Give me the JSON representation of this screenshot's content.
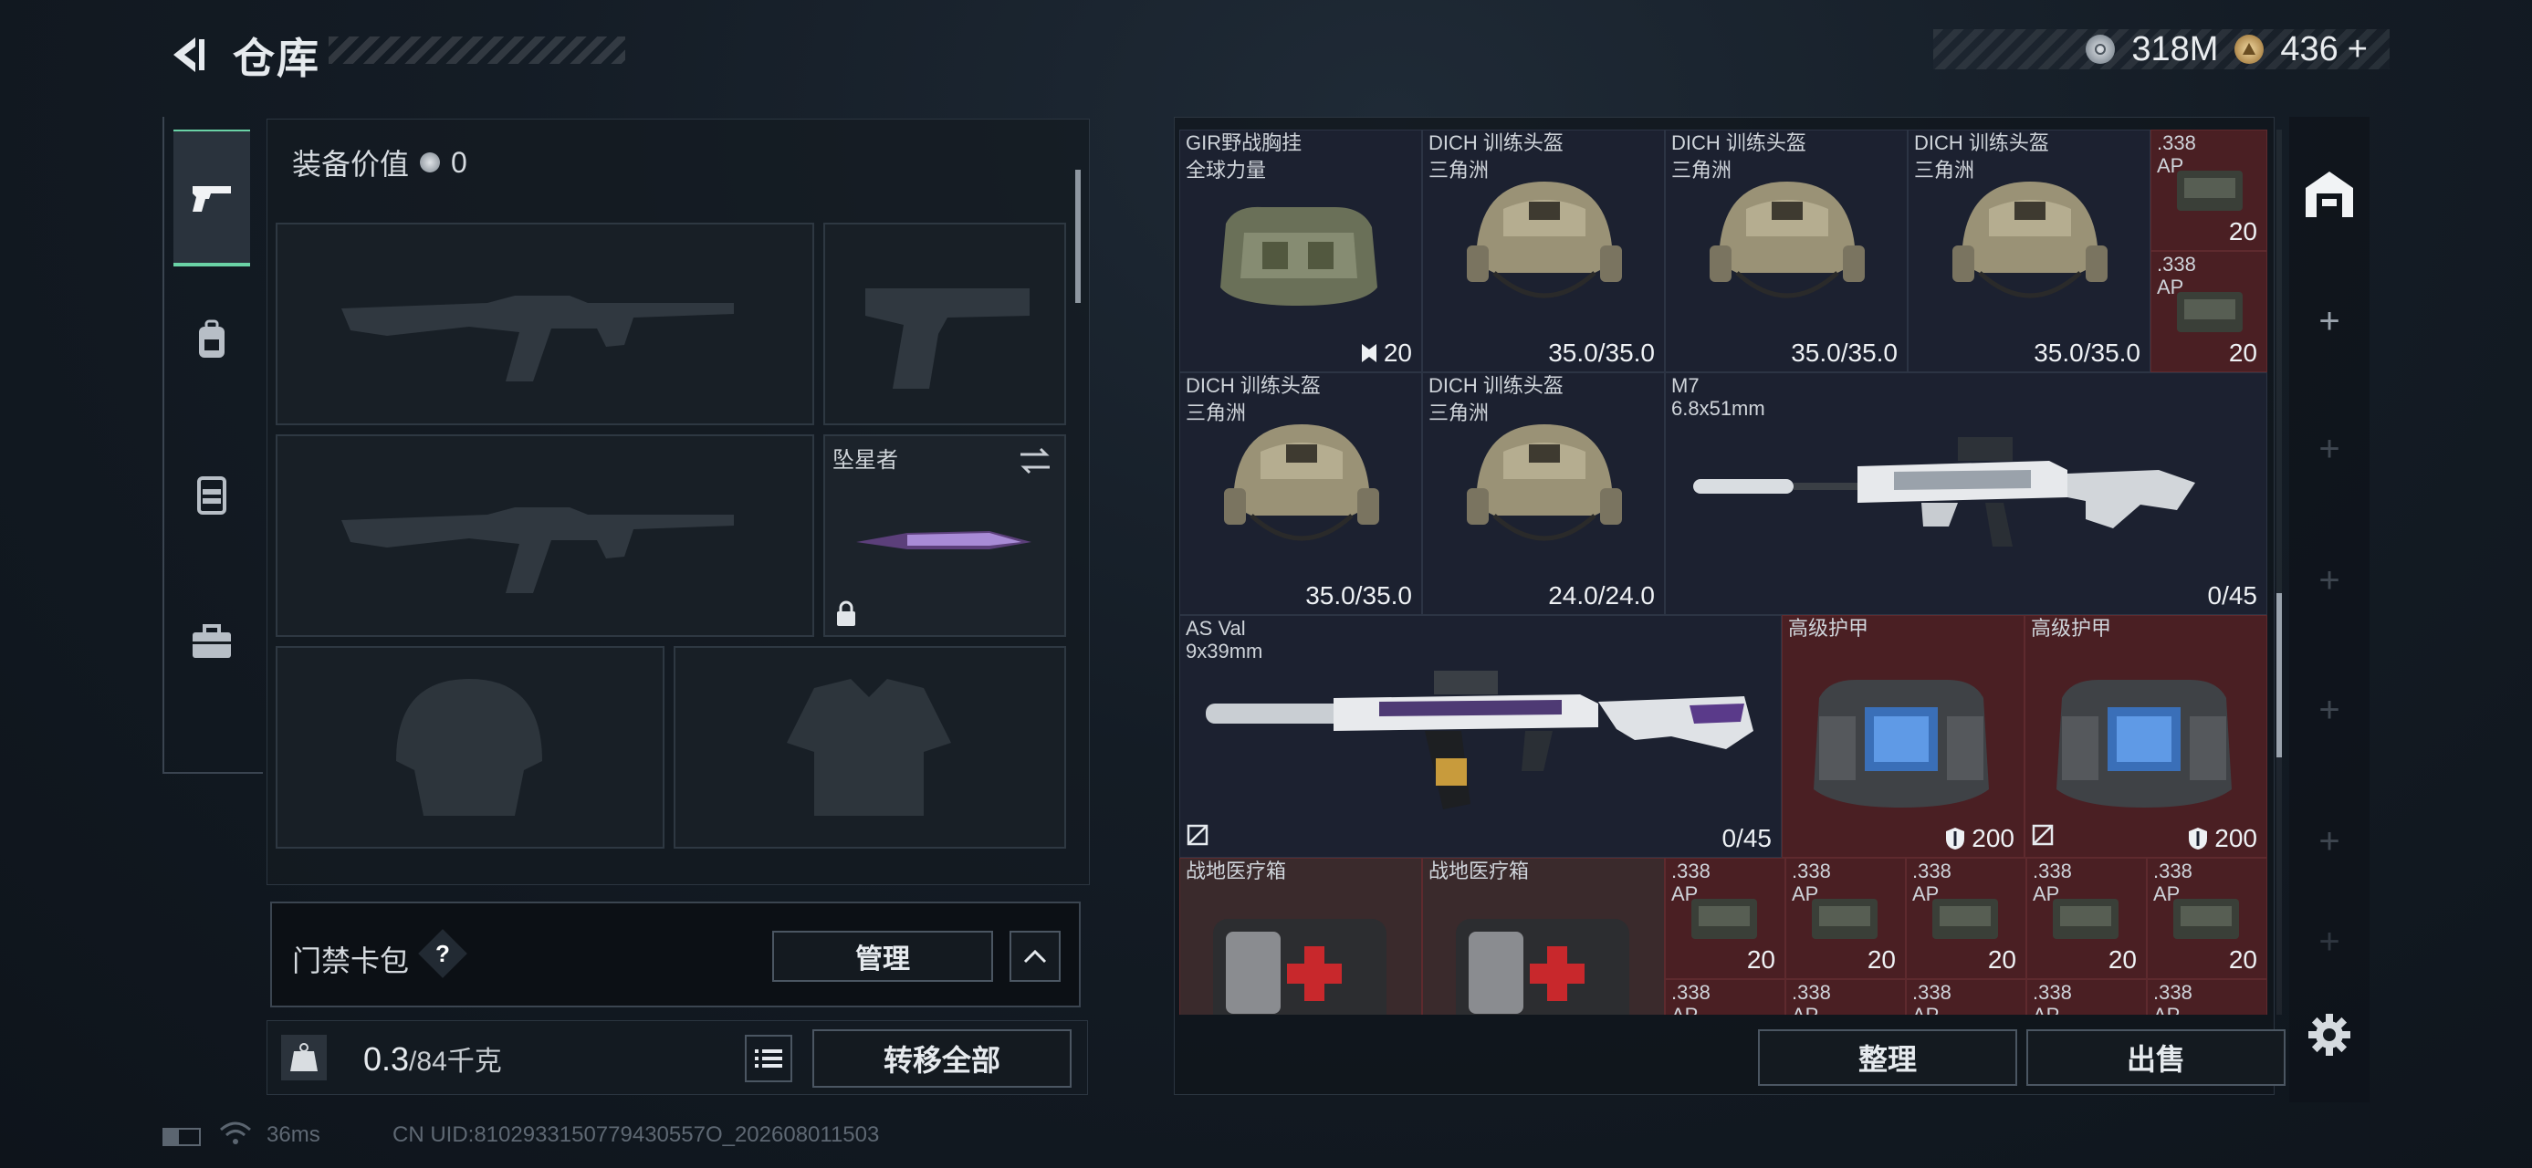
{
  "header": {
    "title": "仓库",
    "back_icon": "back-arrow-icon"
  },
  "currency": [
    {
      "icon": "silver-coin-icon",
      "value": "318M",
      "color": "#9aa4ae"
    },
    {
      "icon": "gold-coin-icon",
      "value": "436",
      "color": "#c8a46a"
    }
  ],
  "currency_add": "+",
  "left_tabs": [
    {
      "icon": "pistol-icon",
      "active": true
    },
    {
      "icon": "backpack-icon",
      "active": false
    },
    {
      "icon": "chest-rig-icon",
      "active": false
    },
    {
      "icon": "toolbox-icon",
      "active": false
    }
  ],
  "equipment": {
    "value_label": "装备价值",
    "value": "0",
    "melee_name": "坠星者"
  },
  "card_pack": {
    "label": "门禁卡包",
    "help": "?",
    "manage": "管理"
  },
  "weight": {
    "current": "0.3",
    "max": "/84千克",
    "icon": "KG"
  },
  "transfer_all": "转移全部",
  "status": {
    "ping": "36ms",
    "uid": "CN UID:8102933150779430557O_202608011503"
  },
  "stash": {
    "items": [
      {
        "name": "GIR野战胸挂",
        "sub": "全球力量",
        "value": "20",
        "icon": "durability-icon"
      },
      {
        "name": "DICH 训练头盔",
        "sub": "三角洲",
        "value": "35.0/35.0"
      },
      {
        "name": "DICH 训练头盔",
        "sub": "三角洲",
        "value": "35.0/35.0"
      },
      {
        "name": "DICH 训练头盔",
        "sub": "三角洲",
        "value": "35.0/35.0"
      },
      {
        "name": ".338",
        "sub": "AP",
        "value": "20"
      },
      {
        "name": ".338",
        "sub": "AP",
        "value": "20"
      },
      {
        "name": "DICH 训练头盔",
        "sub": "三角洲",
        "value": "35.0/35.0"
      },
      {
        "name": "DICH 训练头盔",
        "sub": "三角洲",
        "value": "24.0/24.0"
      },
      {
        "name": "M7",
        "sub": "6.8x51mm",
        "value": "0/45"
      },
      {
        "name": "AS Val",
        "sub": "9x39mm",
        "value": "0/45"
      },
      {
        "name": "高级护甲",
        "sub": "",
        "value": "200"
      },
      {
        "name": "高级护甲",
        "sub": "",
        "value": "200"
      },
      {
        "name": "战地医疗箱",
        "sub": "",
        "value": ""
      },
      {
        "name": "战地医疗箱",
        "sub": "",
        "value": ""
      },
      {
        "name": ".338",
        "sub": "AP",
        "value": "20"
      },
      {
        "name": ".338",
        "sub": "AP",
        "value": "20"
      },
      {
        "name": ".338",
        "sub": "AP",
        "value": "20"
      },
      {
        "name": ".338",
        "sub": "AP",
        "value": "20"
      },
      {
        "name": ".338",
        "sub": "AP",
        "value": "20"
      },
      {
        "name": ".338",
        "sub": "AP",
        "value": ""
      },
      {
        "name": ".338",
        "sub": "AP",
        "value": ""
      },
      {
        "name": ".338",
        "sub": "AP",
        "value": ""
      },
      {
        "name": ".338",
        "sub": "AP",
        "value": ""
      },
      {
        "name": ".338",
        "sub": "AP",
        "value": ""
      }
    ]
  },
  "buttons": {
    "sort": "整理",
    "sell": "出售"
  },
  "right_tabs": {
    "storage_icon": "warehouse-icon",
    "add": "+"
  }
}
